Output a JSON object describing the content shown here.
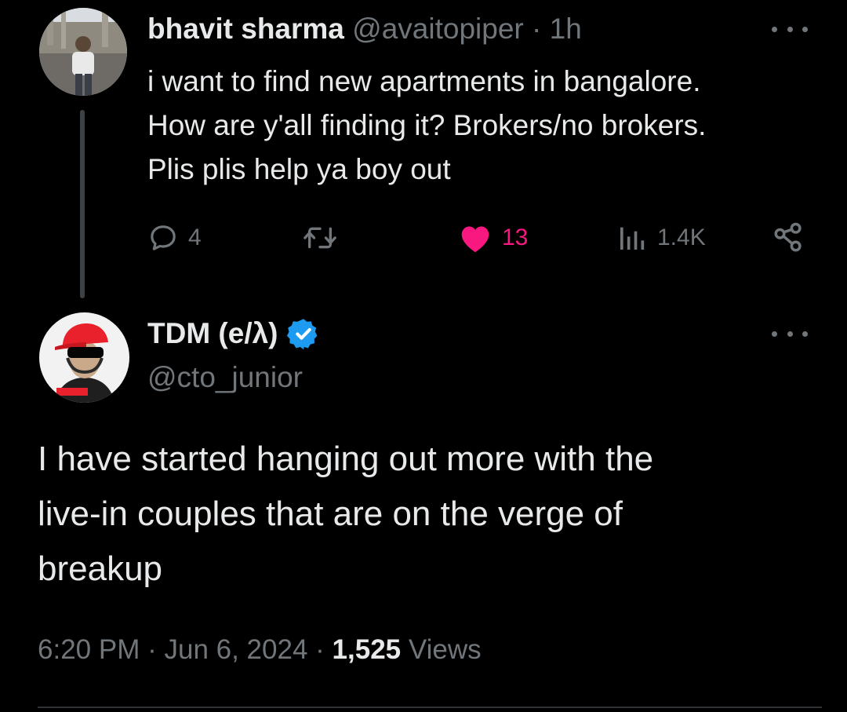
{
  "parent_tweet": {
    "author_name": "bhavit sharma",
    "handle": "@avaitopiper",
    "separator": "·",
    "time_ago": "1h",
    "text": "i want to find new apartments in bangalore.\nHow are y'all finding it? Brokers/no brokers.\nPlis plis help ya boy out",
    "replies": "4",
    "likes": "13",
    "views": "1.4K",
    "liked": true,
    "avatar_icon": "profile-photo"
  },
  "reply_tweet": {
    "author_name": "TDM (e/λ)",
    "handle": "@cto_junior",
    "verified": true,
    "avatar_icon": "profile-photo",
    "text": "I have started hanging out more with the\nlive-in couples that are on the verge of\nbreakup",
    "time": "6:20 PM",
    "separator": "·",
    "date": "Jun 6, 2024",
    "view_count": "1,525",
    "views_label": "Views"
  },
  "colors": {
    "background": "#000000",
    "text_primary": "#e7e9ea",
    "text_muted": "#71767b",
    "like_pink": "#f91880",
    "verified_blue": "#1d9bf0",
    "thread_line": "#3d4247"
  },
  "icons": {
    "more": "more-dots-icon",
    "reply": "reply-bubble-icon",
    "retweet": "retweet-icon",
    "like": "heart-icon",
    "views": "views-bar-chart-icon",
    "share": "share-icon",
    "verified": "verified-badge-icon"
  }
}
